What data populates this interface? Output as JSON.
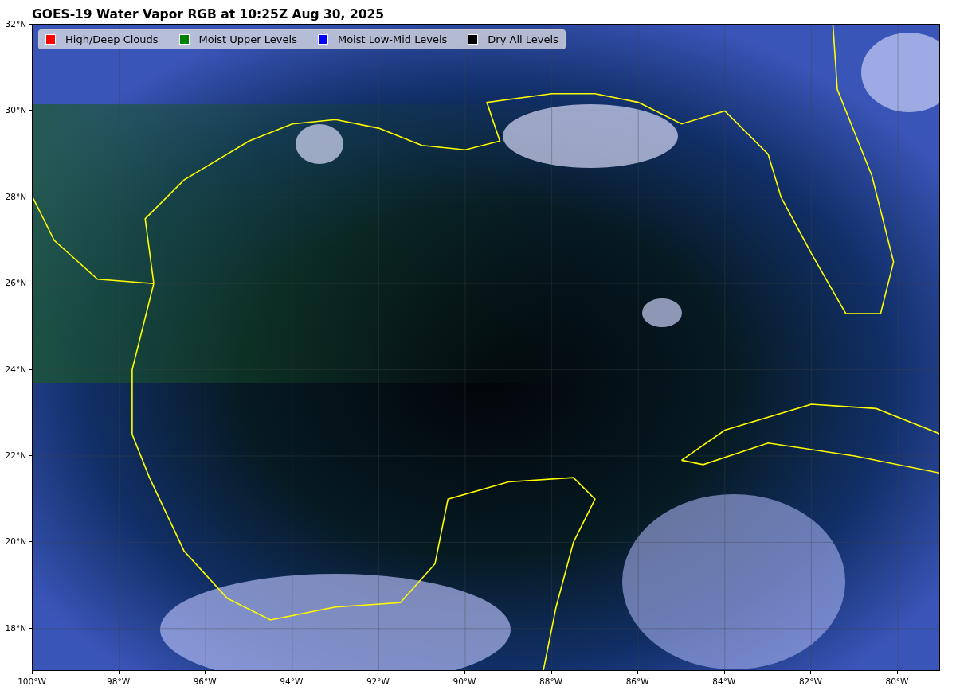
{
  "title": "GOES-19 Water Vapor RGB at 10:25Z Aug 30, 2025",
  "legend": [
    {
      "label": "High/Deep Clouds",
      "color": "#ff0000"
    },
    {
      "label": "Moist Upper Levels",
      "color": "#008000"
    },
    {
      "label": "Moist Low-Mid Levels",
      "color": "#0000ff"
    },
    {
      "label": "Dry All Levels",
      "color": "#000000"
    }
  ],
  "y_ticks": [
    "32°N",
    "30°N",
    "28°N",
    "26°N",
    "24°N",
    "22°N",
    "20°N",
    "18°N"
  ],
  "x_ticks": [
    "100°W",
    "98°W",
    "96°W",
    "94°W",
    "92°W",
    "90°W",
    "88°W",
    "86°W",
    "84°W",
    "82°W",
    "80°W"
  ]
}
